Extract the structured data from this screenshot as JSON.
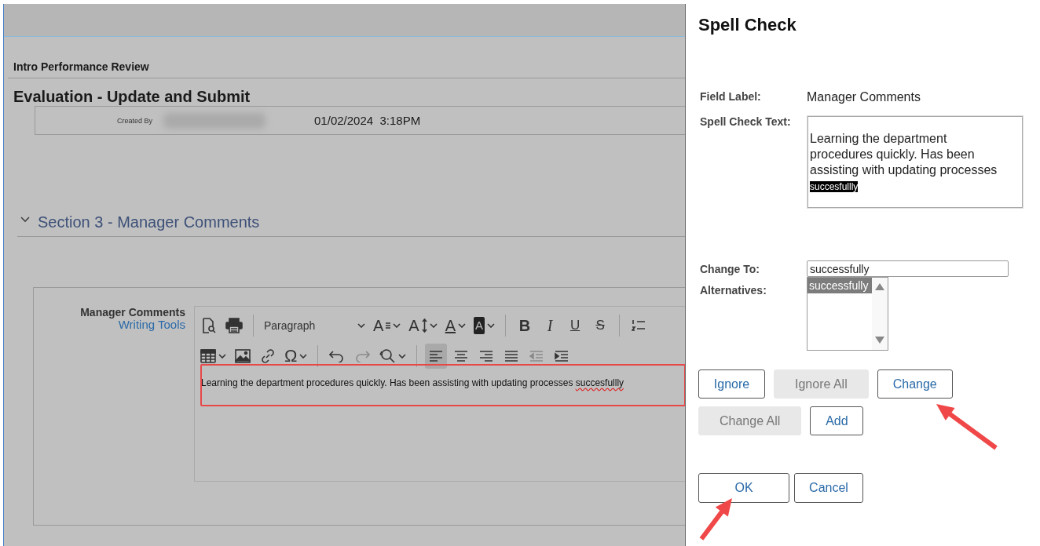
{
  "page": {
    "breadcrumb": "Intro Performance Review",
    "title": "Evaluation - Update and Submit",
    "created_by_label": "Created By",
    "created_at": "01/02/2024  3:18PM"
  },
  "section": {
    "title": "Section 3 - Manager Comments",
    "expanded": true
  },
  "editor": {
    "label": "Manager Comments",
    "link": "Writing Tools",
    "toolbar_rows": [
      [
        [
          {
            "kind": "preview",
            "selected": false,
            "disabled": false,
            "dropdown": false
          },
          {
            "kind": "print",
            "selected": false,
            "disabled": false,
            "dropdown": false
          }
        ],
        [
          {
            "kind": "format",
            "label": "Paragraph",
            "selected": false,
            "disabled": false,
            "dropdown": true
          },
          {
            "kind": "font-family",
            "label": "A",
            "selected": false,
            "disabled": false,
            "dropdown": true
          },
          {
            "kind": "font-size",
            "label": "A",
            "selected": false,
            "disabled": false,
            "dropdown": true
          },
          {
            "kind": "text-color",
            "label": "A",
            "selected": false,
            "disabled": false,
            "dropdown": true
          },
          {
            "kind": "highlight-color",
            "label": "A",
            "selected": false,
            "disabled": false,
            "dropdown": true
          }
        ],
        [
          {
            "kind": "bold",
            "label": "B",
            "selected": false,
            "disabled": false,
            "dropdown": false
          },
          {
            "kind": "italic",
            "label": "I",
            "selected": false,
            "disabled": false,
            "dropdown": false
          },
          {
            "kind": "underline",
            "label": "U",
            "selected": false,
            "disabled": false,
            "dropdown": false
          },
          {
            "kind": "strikethrough",
            "label": "S",
            "selected": false,
            "disabled": false,
            "dropdown": false
          }
        ],
        [
          {
            "kind": "numbered-list",
            "selected": false,
            "disabled": false,
            "dropdown": false
          }
        ]
      ],
      [
        [
          {
            "kind": "table",
            "selected": false,
            "disabled": false,
            "dropdown": true
          },
          {
            "kind": "image",
            "selected": false,
            "disabled": false,
            "dropdown": false
          },
          {
            "kind": "link",
            "selected": false,
            "disabled": false,
            "dropdown": false
          },
          {
            "kind": "special-character",
            "label": "Ω",
            "selected": false,
            "disabled": false,
            "dropdown": true
          }
        ],
        [
          {
            "kind": "undo",
            "selected": false,
            "disabled": false,
            "dropdown": false
          },
          {
            "kind": "redo",
            "selected": false,
            "disabled": true,
            "dropdown": false
          },
          {
            "kind": "find-replace",
            "selected": false,
            "disabled": false,
            "dropdown": true
          }
        ],
        [
          {
            "kind": "align-left",
            "selected": true,
            "disabled": false,
            "dropdown": false
          },
          {
            "kind": "align-center",
            "selected": false,
            "disabled": false,
            "dropdown": false
          },
          {
            "kind": "align-right",
            "selected": false,
            "disabled": false,
            "dropdown": false
          },
          {
            "kind": "justify",
            "selected": false,
            "disabled": false,
            "dropdown": false
          },
          {
            "kind": "outdent",
            "selected": false,
            "disabled": true,
            "dropdown": false
          },
          {
            "kind": "indent",
            "selected": false,
            "disabled": false,
            "dropdown": false
          }
        ]
      ]
    ],
    "content": {
      "text": "Learning the department procedures quickly. Has been assisting with updating processes ",
      "misspelled": "succesfullly"
    }
  },
  "dialog": {
    "title": "Spell Check",
    "field_label": {
      "label": "Field Label:",
      "value": "Manager Comments"
    },
    "spell_check_text": {
      "label": "Spell Check Text:",
      "text": "Learning the department procedures quickly. Has been assisting with updating processes ",
      "highlighted": "succesfullly"
    },
    "change_to": {
      "label": "Change To:",
      "value": "successfully"
    },
    "alternatives": {
      "label": "Alternatives:",
      "items": [
        {
          "text": "successfully",
          "selected": true
        }
      ]
    },
    "action_rows": [
      [
        {
          "label": "Ignore",
          "disabled": false
        },
        {
          "label": "Ignore All",
          "disabled": true
        },
        {
          "label": "Change",
          "disabled": false
        }
      ],
      [
        {
          "label": "Change All",
          "disabled": true
        },
        {
          "label": "Add",
          "disabled": false
        }
      ]
    ],
    "footer_buttons": [
      {
        "label": "OK",
        "disabled": false
      },
      {
        "label": "Cancel",
        "disabled": false
      }
    ]
  }
}
